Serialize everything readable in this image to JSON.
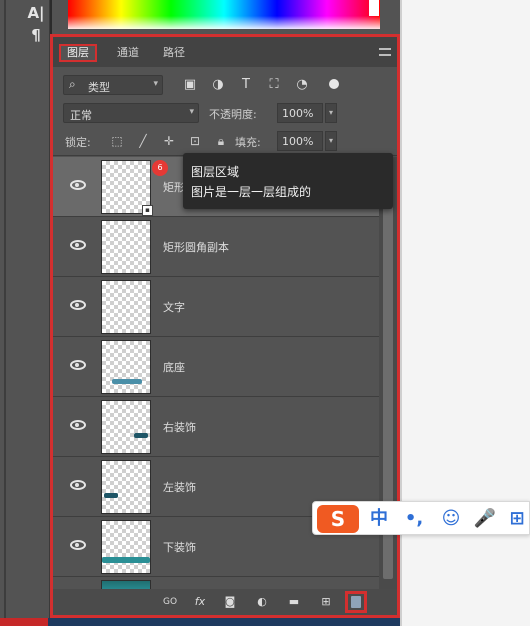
{
  "toolbar": {
    "tool_glyph_1": "A|",
    "tool_glyph_2": "¶"
  },
  "layers_panel": {
    "tabs": [
      {
        "label": "图层",
        "active": true
      },
      {
        "label": "通道",
        "active": false
      },
      {
        "label": "路径",
        "active": false
      }
    ],
    "filter": {
      "value": "类型",
      "icon": "search-icon"
    },
    "filter_icons": [
      "image-filter-icon",
      "adjustment-filter-icon",
      "type-filter-icon",
      "shape-filter-icon",
      "smart-object-filter-icon",
      "filter-toggle-icon"
    ],
    "blend_mode": "正常",
    "opacity_label": "不透明度:",
    "opacity_value": "100%",
    "lock_label": "锁定:",
    "fill_label": "填充:",
    "fill_value": "100%",
    "lock_icons": [
      "lock-transparent-icon",
      "lock-pixels-icon",
      "lock-position-icon",
      "lock-artboard-icon",
      "lock-all-icon"
    ],
    "layers": [
      {
        "name": "矩形",
        "visible": true,
        "selected": true,
        "smart_object": true
      },
      {
        "name": "矩形圆角副本",
        "visible": true,
        "selected": false
      },
      {
        "name": "文字",
        "visible": true,
        "selected": false
      },
      {
        "name": "底座",
        "visible": true,
        "selected": false
      },
      {
        "name": "右装饰",
        "visible": true,
        "selected": false
      },
      {
        "name": "左装饰",
        "visible": true,
        "selected": false
      },
      {
        "name": "下装饰",
        "visible": true,
        "selected": false
      }
    ],
    "tooltip": {
      "badge": "6",
      "line1": "图层区域",
      "line2": "图片是一层一层组成的"
    },
    "bottom_icons": [
      "link-layers-icon",
      "fx-icon",
      "mask-icon",
      "adjustment-icon",
      "folder-icon",
      "new-layer-icon",
      "trash-icon"
    ],
    "bottom_labels": {
      "link": "GO",
      "fx": "fx"
    }
  },
  "ime": {
    "logo": "S",
    "items": [
      "中",
      "•,",
      "☺",
      "🎤",
      "⊞"
    ]
  },
  "colors": {
    "highlight_red": "#d32f2f",
    "panel_bg": "#535353",
    "ime_orange": "#f05a22",
    "ime_blue": "#2f6fd6"
  }
}
